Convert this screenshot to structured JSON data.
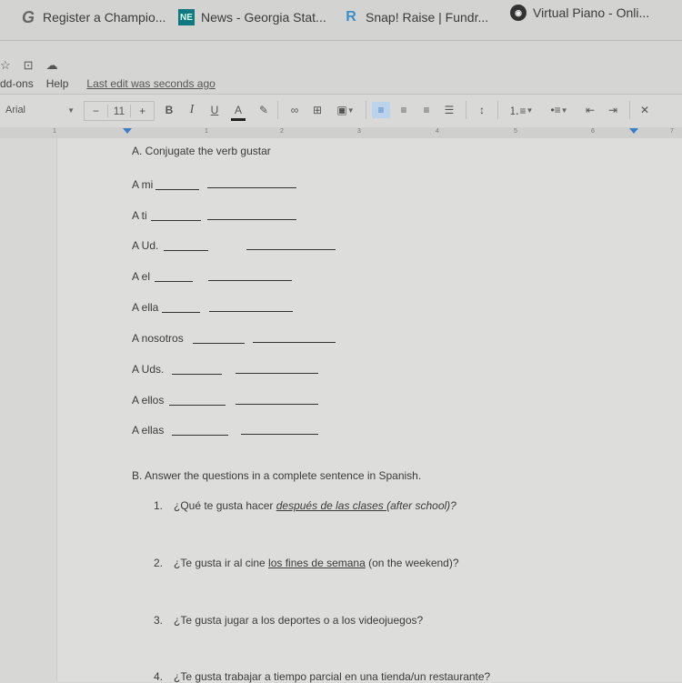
{
  "bookmarks": [
    {
      "icon": "g-logo-icon",
      "label": "Register a Champio..."
    },
    {
      "icon": "ne-logo-icon",
      "label": "News - Georgia Stat..."
    },
    {
      "icon": "snap-raise-logo-icon",
      "label": "Snap! Raise | Fundr..."
    },
    {
      "icon": "virtual-piano-logo-icon",
      "label": "Virtual Piano - Onli..."
    }
  ],
  "menu": {
    "items": [
      "dd-ons",
      "Help"
    ],
    "last_edit": "Last edit was seconds ago"
  },
  "toolbar": {
    "font": "Arial",
    "font_size": "11",
    "minus": "−",
    "plus": "+",
    "bold": "B",
    "italic": "I",
    "underline": "U",
    "text_color": "A"
  },
  "ruler": {
    "numbers": [
      "1",
      "1",
      "2",
      "3",
      "4",
      "5",
      "6",
      "7"
    ]
  },
  "document": {
    "section_a": {
      "heading": "A. Conjugate the verb gustar",
      "rows": [
        "A mi",
        "A ti",
        "A Ud.",
        "A el",
        "A ella",
        "A nosotros",
        "A Uds.",
        "A ellos",
        "A ellas"
      ]
    },
    "section_b": {
      "heading": "B. Answer the questions in a complete sentence in Spanish.",
      "questions": [
        {
          "num": "1.",
          "pre": "¿Qué te gusta hacer ",
          "underlined": "después de las clases ",
          "post": "(after school)?"
        },
        {
          "num": "2.",
          "pre": "¿Te gusta ir al cine ",
          "underlined": "los fines de semana",
          "post": " (on the weekend)?"
        },
        {
          "num": "3.",
          "pre": "¿Te gusta jugar a los deportes o a los videojuegos?",
          "underlined": "",
          "post": ""
        },
        {
          "num": "4.",
          "pre": "¿Te gusta trabajar a tiempo parcial en una tienda/un restaurante?",
          "underlined": "",
          "post": ""
        }
      ]
    }
  },
  "colors": {
    "accent": "#3a7dc9",
    "page_bg": "#dddedc"
  }
}
